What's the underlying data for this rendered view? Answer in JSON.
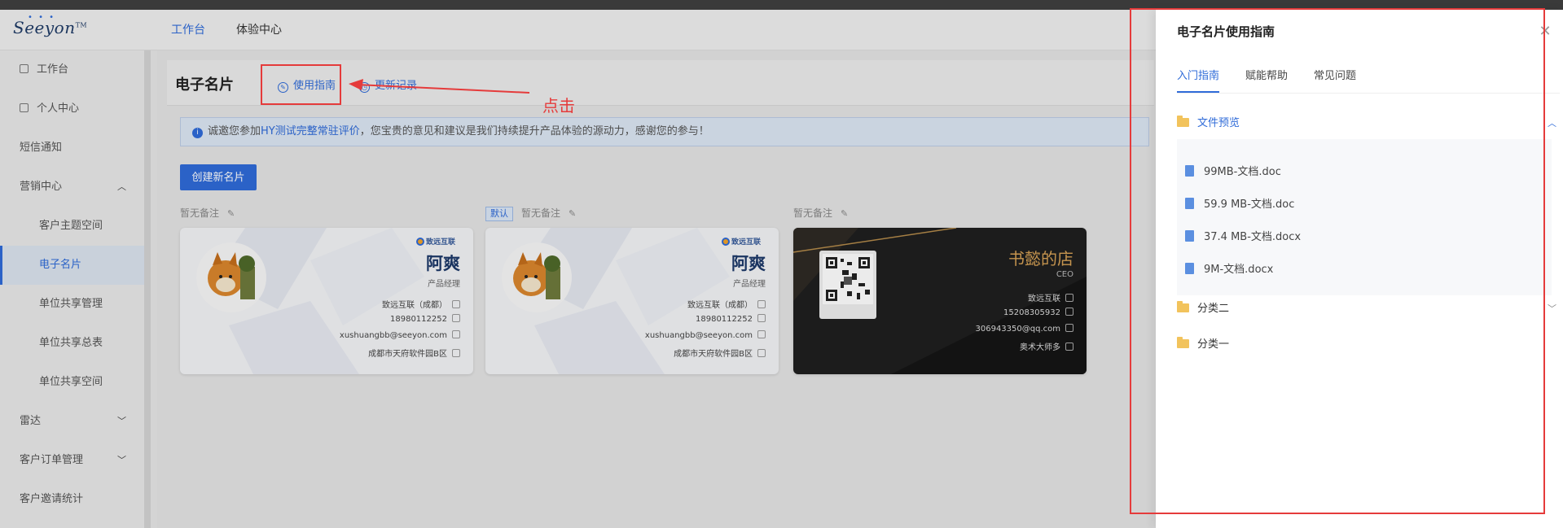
{
  "header": {
    "logo": "Seeyon",
    "logo_tm": "TM",
    "nav": [
      "工作台",
      "体验中心"
    ]
  },
  "sidebar": {
    "items": [
      {
        "label": "工作台"
      },
      {
        "label": "个人中心"
      },
      {
        "label": "短信通知"
      },
      {
        "label": "营销中心"
      },
      {
        "label": "客户主题空间"
      },
      {
        "label": "电子名片"
      },
      {
        "label": "单位共享管理"
      },
      {
        "label": "单位共享总表"
      },
      {
        "label": "单位共享空间"
      },
      {
        "label": "雷达"
      },
      {
        "label": "客户订单管理"
      },
      {
        "label": "客户邀请统计"
      }
    ]
  },
  "main": {
    "title": "电子名片",
    "guide_link": "使用指南",
    "update_link": "更新记录",
    "annotation": "点击",
    "notice_pre": "诚邀您参加",
    "notice_link": "HY测试完整常驻评价",
    "notice_post": "，您宝贵的意见和建议是我们持续提升产品体验的源动力，感谢您的参与！",
    "create_button": "创建新名片",
    "cards": [
      {
        "remark": "暂无备注",
        "default_tag": "",
        "brand": "致远互联",
        "name": "阿爽",
        "role": "产品经理",
        "company": "致远互联（成都）",
        "phone": "18980112252",
        "email": "xushuangbb@seeyon.com",
        "address": "成都市天府软件园B区"
      },
      {
        "remark": "暂无备注",
        "default_tag": "默认",
        "brand": "致远互联",
        "name": "阿爽",
        "role": "产品经理",
        "company": "致远互联（成都）",
        "phone": "18980112252",
        "email": "xushuangbb@seeyon.com",
        "address": "成都市天府软件园B区"
      },
      {
        "remark": "暂无备注",
        "default_tag": "",
        "name": "书懿的店",
        "role": "CEO",
        "company": "致远互联",
        "phone": "15208305932",
        "email": "306943350@qq.com",
        "address": "奥术大师多"
      }
    ]
  },
  "drawer": {
    "title": "电子名片使用指南",
    "tabs": [
      "入门指南",
      "赋能帮助",
      "常见问题"
    ],
    "folders": [
      {
        "label": "文件预览",
        "files": [
          "99MB-文档.doc",
          "59.9 MB-文档.doc",
          "37.4 MB-文档.docx",
          "9M-文档.docx"
        ]
      },
      {
        "label": "分类二"
      },
      {
        "label": "分类一"
      }
    ]
  },
  "colors": {
    "accent": "#2f6bd8",
    "annotation": "#e53b3b",
    "folder": "#f2c35c"
  }
}
